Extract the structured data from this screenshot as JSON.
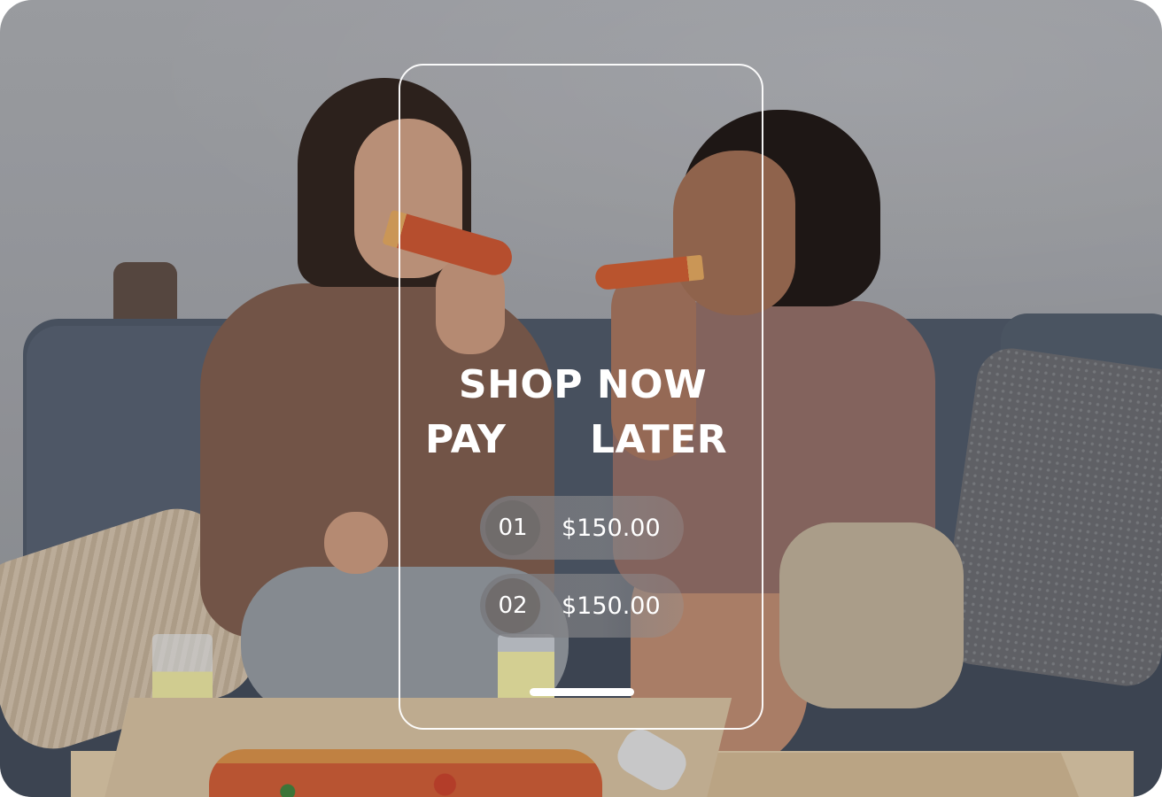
{
  "promo": {
    "headline_line1": "SHOP NOW",
    "headline_word_pay": "PAY",
    "headline_word_later": "LATER"
  },
  "installments": [
    {
      "number": "01",
      "amount": "$150.00"
    },
    {
      "number": "02",
      "amount": "$150.00"
    }
  ],
  "colors": {
    "text": "#ffffff",
    "frame": "#ffffff",
    "pill_background": "#7a7a7e"
  },
  "photo": {
    "subject_icon_names": [
      "pizza-icon",
      "glass-icon",
      "sofa-icon",
      "pillow-icon"
    ]
  }
}
